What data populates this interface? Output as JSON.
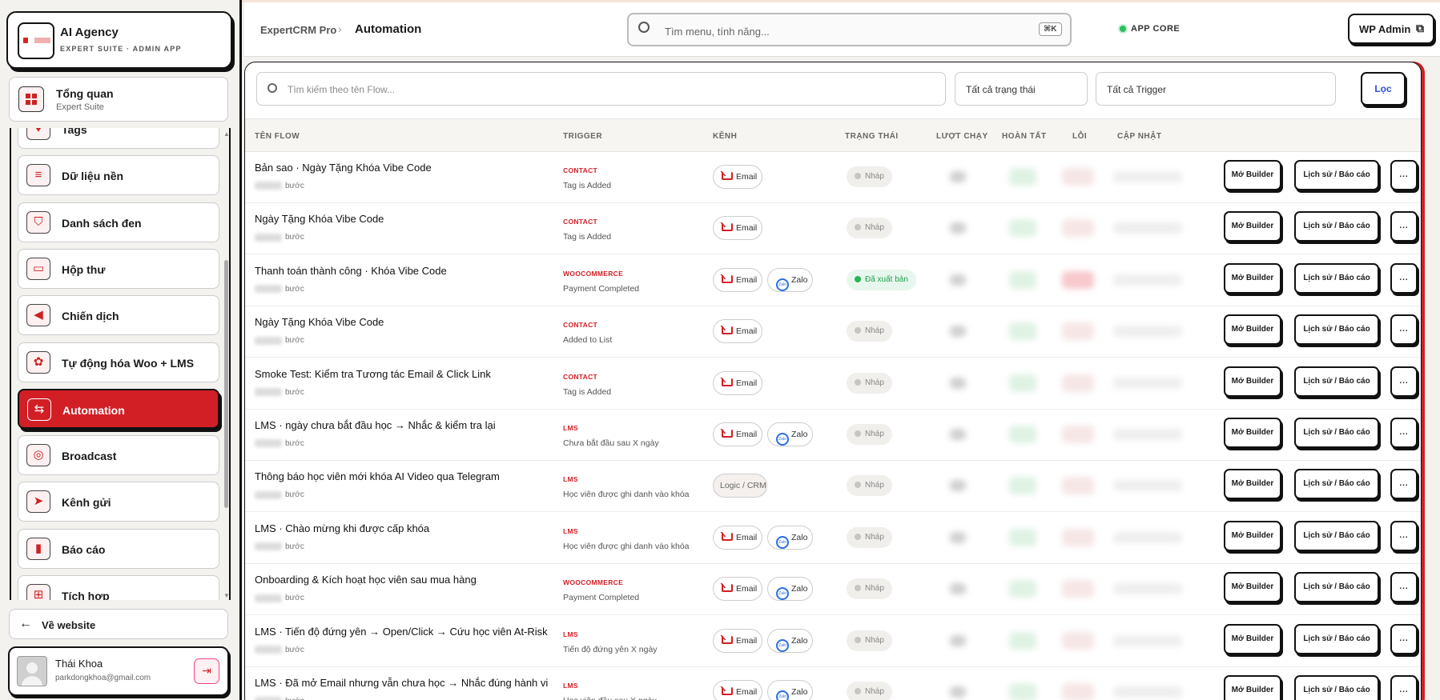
{
  "app": {
    "name": "AI Agency",
    "subtitle": "EXPERT SUITE · ADMIN APP"
  },
  "overview": {
    "title": "Tổng quan",
    "subtitle": "Expert Suite"
  },
  "nav": [
    {
      "label": "Tags",
      "icon": "tag-icon",
      "glyph": "♥"
    },
    {
      "label": "Dữ liệu nền",
      "icon": "database-icon",
      "glyph": "≡"
    },
    {
      "label": "Danh sách đen",
      "icon": "shield-icon",
      "glyph": "⛉"
    },
    {
      "label": "Hộp thư",
      "icon": "inbox-icon",
      "glyph": "▭"
    },
    {
      "label": "Chiến dịch",
      "icon": "megaphone-icon",
      "glyph": "◀"
    },
    {
      "label": "Tự động hóa Woo + LMS",
      "icon": "automation-icon",
      "glyph": "✿"
    },
    {
      "label": "Automation",
      "icon": "workflow-icon",
      "glyph": "⇆",
      "active": true
    },
    {
      "label": "Broadcast",
      "icon": "broadcast-icon",
      "glyph": "◎"
    },
    {
      "label": "Kênh gửi",
      "icon": "send-icon",
      "glyph": "➤"
    },
    {
      "label": "Báo cáo",
      "icon": "report-icon",
      "glyph": "▮"
    },
    {
      "label": "Tích hợp",
      "icon": "integration-icon",
      "glyph": "⊞"
    }
  ],
  "back_label": "Về website",
  "user": {
    "name": "Thái Khoa",
    "email": "parkdongkhoa@gmail.com"
  },
  "header": {
    "breadcrumb_root": "ExpertCRM Pro",
    "breadcrumb_current": "Automation",
    "search_placeholder": "Tìm menu, tính năng...",
    "shortcut": "⌘K",
    "status_label": "APP CORE",
    "wp_admin_label": "WP Admin"
  },
  "filters": {
    "search_placeholder": "Tìm kiếm theo tên Flow...",
    "status_select": "Tất cả trạng thái",
    "trigger_select": "Tất cả Trigger",
    "filter_button": "Lọc"
  },
  "table": {
    "columns": [
      "TÊN FLOW",
      "TRIGGER",
      "KÊNH",
      "TRẠNG THÁI",
      "LƯỢT CHẠY",
      "HOÀN TẤT",
      "LỖI",
      "CẬP NHẬT"
    ],
    "steps_suffix": "bước",
    "action_builder": "Mở Builder",
    "action_history": "Lịch sử / Báo cáo",
    "action_more": "...",
    "rows": [
      {
        "name": "Bản sao ·  Ngày Tặng Khóa Vibe Code",
        "trigger_type": "CONTACT",
        "trigger": "Tag is Added",
        "channels": [
          "Email"
        ],
        "status": "Nháp"
      },
      {
        "name": "Ngày Tặng Khóa Vibe Code",
        "trigger_type": "CONTACT",
        "trigger": "Tag is Added",
        "channels": [
          "Email"
        ],
        "status": "Nháp"
      },
      {
        "name": "Thanh toán thành công · Khóa Vibe Code",
        "trigger_type": "WOOCOMMERCE",
        "trigger": "Payment Completed",
        "channels": [
          "Email",
          "Zalo"
        ],
        "status": "Đã xuất bản",
        "published": true
      },
      {
        "name": "Ngày Tặng Khóa Vibe Code",
        "trigger_type": "CONTACT",
        "trigger": "Added to List",
        "channels": [
          "Email"
        ],
        "status": "Nháp"
      },
      {
        "name": "Smoke Test: Kiểm tra Tương tác Email & Click Link",
        "trigger_type": "CONTACT",
        "trigger": "Tag is Added",
        "channels": [
          "Email"
        ],
        "status": "Nháp"
      },
      {
        "name": "LMS  ·  ngày chưa bắt đầu học → Nhắc & kiểm tra lại",
        "trigger_type": "LMS",
        "trigger": "Chưa bắt đầu sau X ngày",
        "channels": [
          "Email",
          "Zalo"
        ],
        "status": "Nháp"
      },
      {
        "name": "Thông báo học viên mới khóa AI Video qua Telegram",
        "trigger_type": "LMS",
        "trigger": "Học viên được ghi danh vào khóa",
        "channels": [
          "Logic / CRM"
        ],
        "status": "Nháp"
      },
      {
        "name": "LMS · Chào mừng khi được cấp khóa",
        "trigger_type": "LMS",
        "trigger": "Học viên được ghi danh vào khóa",
        "channels": [
          "Email",
          "Zalo"
        ],
        "status": "Nháp"
      },
      {
        "name": "Onboarding & Kích hoạt học viên sau mua hàng",
        "trigger_type": "WOOCOMMERCE",
        "trigger": "Payment Completed",
        "channels": [
          "Email",
          "Zalo"
        ],
        "status": "Nháp"
      },
      {
        "name": "LMS · Tiến độ đứng yên → Open/Click → Cứu học viên At-Risk",
        "trigger_type": "LMS",
        "trigger": "Tiến độ đứng yên X ngày",
        "channels": [
          "Email",
          "Zalo"
        ],
        "status": "Nháp"
      },
      {
        "name": "LMS · Đã mở Email nhưng vẫn chưa học → Nhắc đúng hành vi",
        "trigger_type": "LMS",
        "trigger": "Học viên đầu sau X ngày",
        "channels": [
          "Email",
          "Zalo"
        ],
        "status": "Nháp"
      }
    ]
  },
  "colors": {
    "accent": "#d21f26",
    "published": "#28b458",
    "filter_link": "#2b4fd8"
  }
}
